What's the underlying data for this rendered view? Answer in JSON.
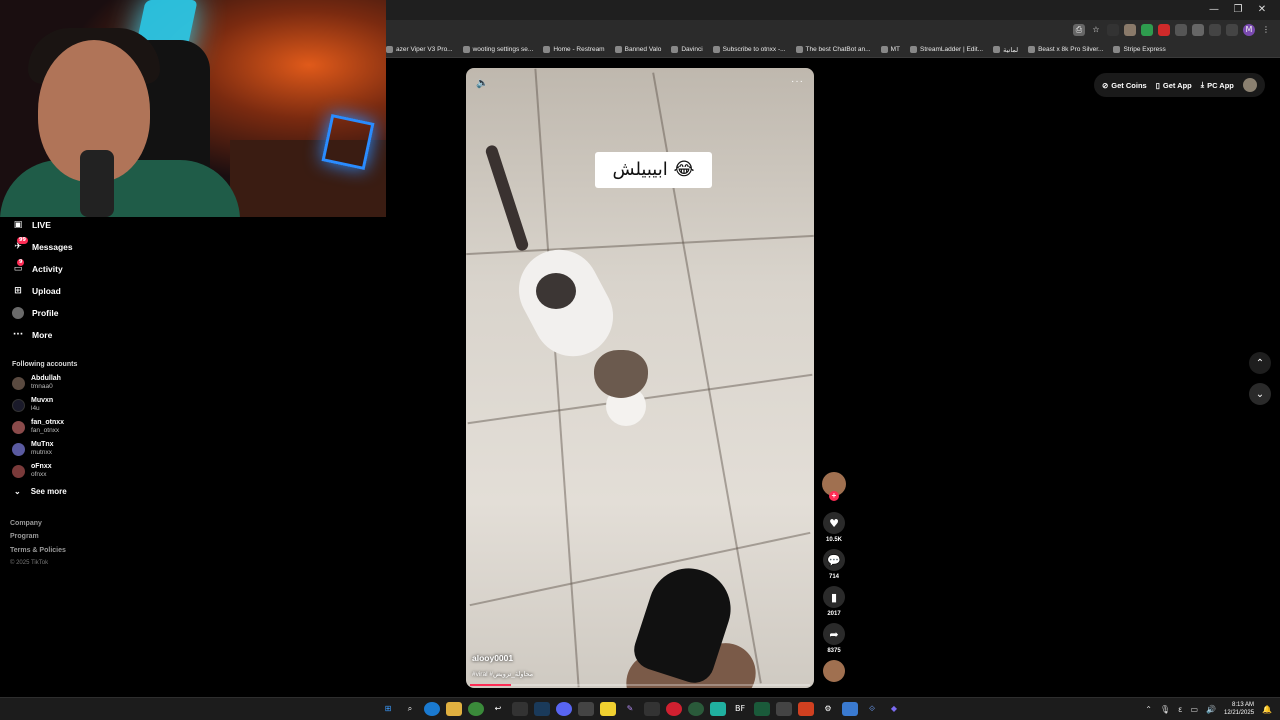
{
  "window": {
    "controls": [
      "—",
      "❐",
      "✕"
    ]
  },
  "bookmarks": [
    "azer Viper V3 Pro...",
    "wooting settings se...",
    "Home - Restream",
    "Banned Valo",
    "Davinci",
    "Subscribe to otnxx -...",
    "The best ChatBot an...",
    "MT",
    "StreamLadder | Edit...",
    "لمانية",
    "Beast x 8k Pro Silver...",
    "Stripe Express"
  ],
  "sidebar": {
    "nav": [
      {
        "label": "LIVE",
        "icon": "live-icon"
      },
      {
        "label": "Messages",
        "icon": "messages-icon",
        "badge": "99"
      },
      {
        "label": "Activity",
        "icon": "activity-icon",
        "badge": "9"
      },
      {
        "label": "Upload",
        "icon": "upload-icon"
      },
      {
        "label": "Profile",
        "icon": "profile-icon"
      },
      {
        "label": "More",
        "icon": "more-icon"
      }
    ],
    "following_title": "Following accounts",
    "accounts": [
      {
        "name": "Abdullah",
        "user": "tmnaa0"
      },
      {
        "name": "Muvxn",
        "user": "l4u"
      },
      {
        "name": "fan_otnxx",
        "user": "fan_otnxx"
      },
      {
        "name": "MuTnx",
        "user": "mutnxx"
      },
      {
        "name": "oFnxx",
        "user": "ofnxx"
      }
    ],
    "see_more": "See more",
    "footer": [
      "Company",
      "Program",
      "Terms & Policies"
    ],
    "copyright": "© 2025 TikTok"
  },
  "video": {
    "caption": "ابيبيلش 😂",
    "author": "alooy0001",
    "tags": "#viral #محاولة_ترويض",
    "progress": 0.12
  },
  "actions": {
    "likes": "10.5K",
    "comments": "714",
    "saves": "2017",
    "shares": "8375"
  },
  "top_right": {
    "get_coins": "Get Coins",
    "get_app": "Get App",
    "pc_app": "PC App"
  },
  "taskbar": {
    "time": "8:13 AM",
    "date": "12/21/2025"
  }
}
